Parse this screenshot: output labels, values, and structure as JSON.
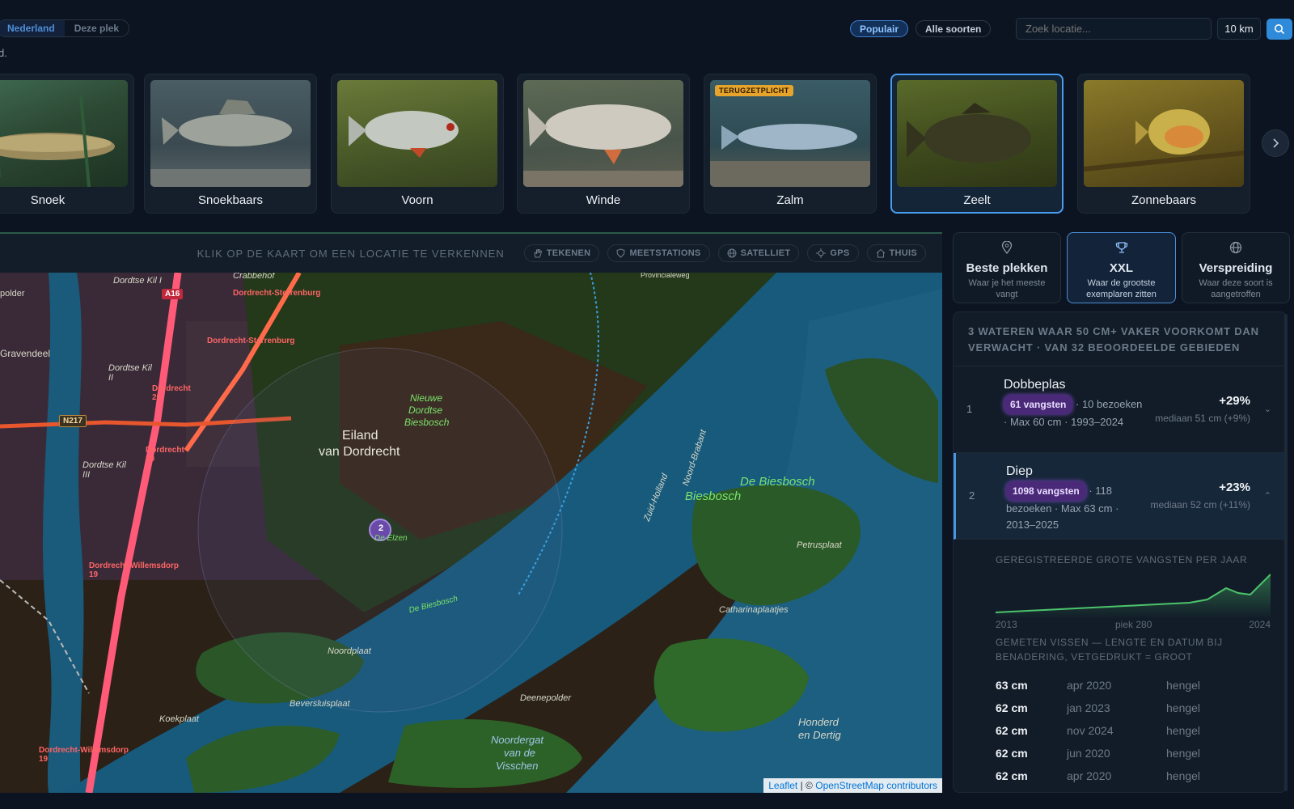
{
  "topbar": {
    "scope_tabs": [
      "Nederland",
      "Deze plek"
    ],
    "active_scope": "Nederland",
    "sub_note": "d.",
    "filters": [
      "Populair",
      "Alle soorten"
    ],
    "active_filter": "Populair",
    "search_placeholder": "Zoek locatie...",
    "radius": "10 km"
  },
  "species": [
    {
      "name": "Snoek"
    },
    {
      "name": "Snoekbaars"
    },
    {
      "name": "Voorn"
    },
    {
      "name": "Winde"
    },
    {
      "name": "Zalm",
      "badge": "TERUGZETPLICHT"
    },
    {
      "name": "Zeelt",
      "selected": true
    },
    {
      "name": "Zonnebaars"
    }
  ],
  "map": {
    "hint": "KLIK OP DE KAART OM EEN LOCATIE TE VERKENNEN",
    "tools": [
      "TEKENEN",
      "MEETSTATIONS",
      "SATELLIET",
      "GPS",
      "THUIS"
    ],
    "cluster_count": "2",
    "attribution": {
      "leaflet": "Leaflet",
      "sep": "| ©",
      "osm": "OpenStreetMap contributors"
    },
    "labels": {
      "eiland1": "Eiland",
      "eiland2": "van Dordrecht",
      "biesbosch": "Biesbosch",
      "debiesbosch": "De Biesbosch",
      "nieuwe1": "Nieuwe",
      "nieuwe2": "Dordtse",
      "nieuwe3": "Biesbosch",
      "gravendeel": "Gravendeel",
      "crabbehof": "Crabbehof",
      "provincialeweg": "Provincialeweg",
      "dordtse_kil1": "Dordtse Kil I",
      "dordtse_kil2": "Dordtse Kil II",
      "dordtse_kil3": "Dordtse Kil III",
      "sterrenburg1": "Dordrecht-Sterrenburg",
      "sterrenburg2": "Dordrecht-Sterrenburg",
      "dordrecht20a": "Dordrecht 20",
      "dordrecht20b": "Dordrecht 20",
      "willemsdorp1": "Dordrecht-Willemsdorp 19",
      "willemsdorp2": "Dordrecht-Willemsdorp 19",
      "a16": "A16",
      "n217": "N217",
      "polder": "polder",
      "catharina": "Catharinaplaatjes",
      "petrusplaat": "Petrusplaat",
      "noordplaat": "Noordplaat",
      "beversluis": "Beversluisplaat",
      "koekplaat": "Koekplaat",
      "deenepolder": "Deenepolder",
      "honderd1": "Honderd",
      "honderd2": "en Dertig",
      "noordergat1": "Noordergat",
      "noordergat2": "van de",
      "noordergat3": "Visschen",
      "zuidholland": "Zuid-Holland",
      "noordbrabant": "Noord-Brabant",
      "deelzen": "De Elzen",
      "debiesbosch2": "De Biesbosch"
    }
  },
  "panel_tabs": [
    {
      "title": "Beste plekken",
      "sub": "Waar je het meeste vangt",
      "icon": "map-pin-icon"
    },
    {
      "title": "XXL",
      "sub": "Waar de grootste exemplaren zitten",
      "icon": "trophy-icon"
    },
    {
      "title": "Verspreiding",
      "sub": "Waar deze soort is aangetroffen",
      "icon": "globe-icon"
    }
  ],
  "active_panel_tab": "XXL",
  "results": {
    "header": "3 WATEREN WAAR 50 CM+ VAKER VOORKOMT DAN VERWACHT · VAN 32 BEOORDEELDE GEBIEDEN",
    "rows": [
      {
        "rank": "1",
        "name": "Dobbeplas",
        "catches": "61 vangsten",
        "detail_a": "· 10",
        "detail_b": "bezoeken · Max 60 cm ·",
        "detail_c": "1993–2024",
        "pct": "+29%",
        "median": "mediaan 51 cm (+9%)"
      },
      {
        "rank": "2",
        "name": "Diep",
        "catches": "1098 vangsten",
        "detail_a": "· 118",
        "detail_b": "bezoeken · Max 63 cm ·",
        "detail_c": "2013–2025",
        "pct": "+23%",
        "median": "mediaan 52 cm (+11%)"
      }
    ],
    "chart_title": "GEREGISTREERDE GROTE VANGSTEN PER JAAR",
    "chart_start": "2013",
    "chart_peak": "piek 280",
    "chart_end": "2024",
    "measured_title": "GEMETEN VISSEN — LENGTE EN DATUM BIJ BENADERING, VETGEDRUKT = GROOT",
    "measured": [
      {
        "len": "63 cm",
        "date": "apr 2020",
        "method": "hengel"
      },
      {
        "len": "62 cm",
        "date": "jan 2023",
        "method": "hengel"
      },
      {
        "len": "62 cm",
        "date": "nov 2024",
        "method": "hengel"
      },
      {
        "len": "62 cm",
        "date": "jun 2020",
        "method": "hengel"
      },
      {
        "len": "62 cm",
        "date": "apr 2020",
        "method": "hengel"
      }
    ]
  }
}
